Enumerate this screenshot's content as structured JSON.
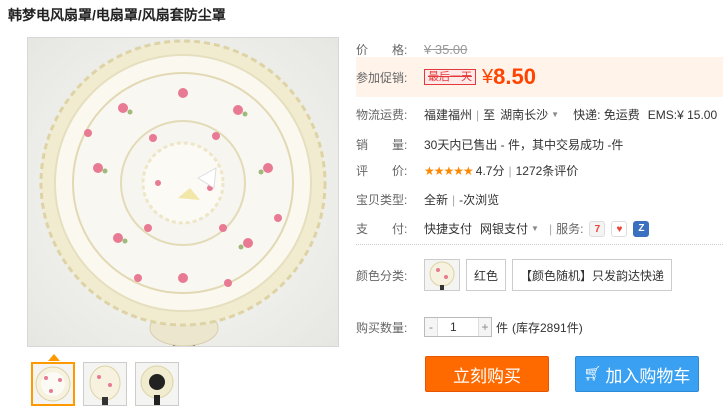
{
  "product": {
    "title": "韩梦电风扇罩/电扇罩/风扇套防尘罩"
  },
  "price": {
    "label": "价　　格:",
    "original": "¥ 35.00"
  },
  "promo": {
    "label": "参加促销:",
    "tag": "最后一天",
    "currency": "¥",
    "price": "8.50"
  },
  "shipping": {
    "label": "物流运费:",
    "from": "福建福州",
    "sep": "|",
    "to_prefix": "至",
    "to": "湖南长沙",
    "express": "快递: 免运费",
    "ems": "EMS:¥ 15.00"
  },
  "sales": {
    "label": "销　　量:",
    "text": "30天内已售出 - 件，其中交易成功 -件"
  },
  "rating": {
    "label": "评　　价:",
    "stars": "★★★★★",
    "score": "4.7分",
    "sep": "|",
    "reviews": "1272条评价"
  },
  "condition": {
    "label": "宝贝类型:",
    "value": "全新",
    "sep": "|",
    "views": "-次浏览"
  },
  "payment": {
    "label": "支　　付:",
    "method1": "快捷支付",
    "method2": "网银支付",
    "service_label": "服务:"
  },
  "color": {
    "label": "颜色分类:",
    "options": [
      "红色",
      "【颜色随机】只发韵达快递"
    ]
  },
  "quantity": {
    "label": "购买数量:",
    "minus": "-",
    "value": "1",
    "plus": "+",
    "unit": "件",
    "stock": "(库存2891件)"
  },
  "actions": {
    "buy_now": "立刻购买",
    "add_cart": "加入购物车"
  },
  "colors": {
    "promo": "#ff4400",
    "buy": "#ff6a00",
    "cart": "#3aa1f2",
    "stars": "#ff8800"
  }
}
